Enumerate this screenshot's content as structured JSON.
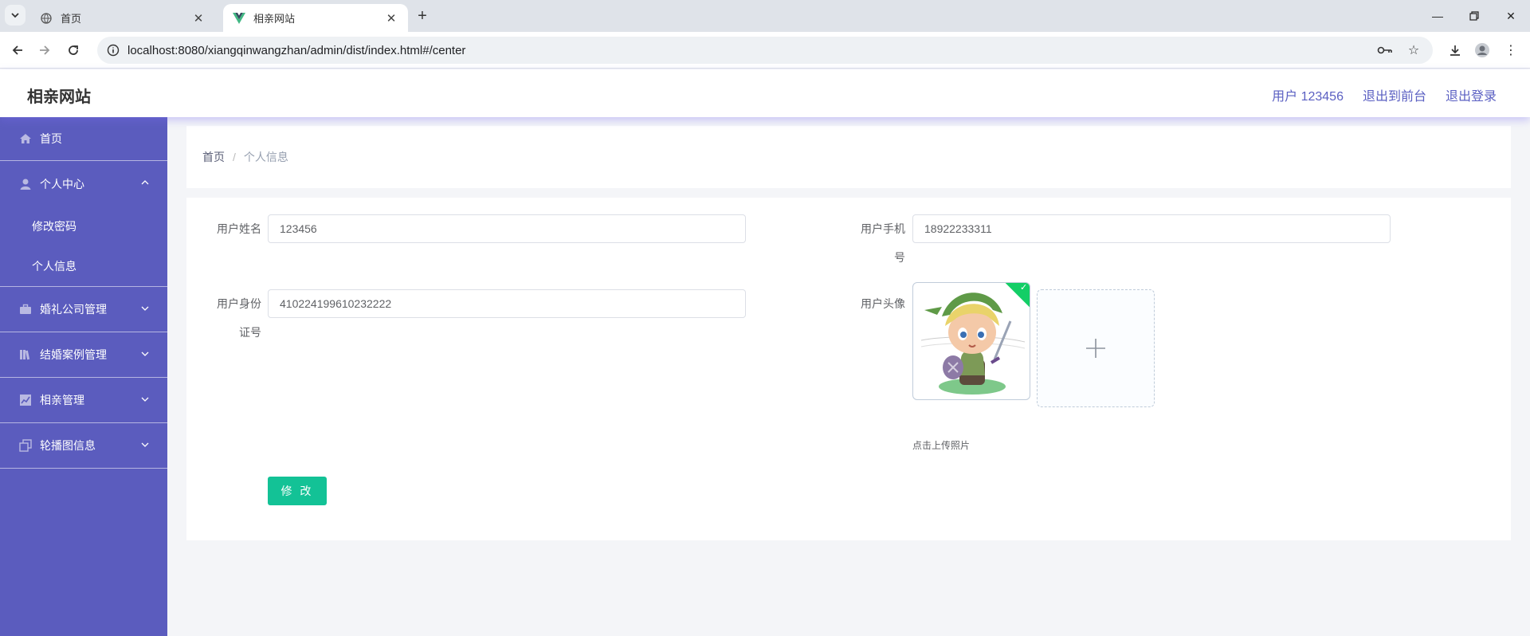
{
  "browser": {
    "tabs": [
      {
        "label": "首页",
        "active": false
      },
      {
        "label": "相亲网站",
        "active": true
      }
    ],
    "url": "localhost:8080/xiangqinwangzhan/admin/dist/index.html#/center"
  },
  "header": {
    "brand": "相亲网站",
    "user_label": "用户 123456",
    "to_front": "退出到前台",
    "logout": "退出登录"
  },
  "sidebar": {
    "home": "首页",
    "personal_center": "个人中心",
    "change_password": "修改密码",
    "personal_info": "个人信息",
    "wedding_company": "婚礼公司管理",
    "wedding_cases": "结婚案例管理",
    "matchmaking": "相亲管理",
    "carousel": "轮播图信息"
  },
  "breadcrumb": {
    "home": "首页",
    "separator": "/",
    "current": "个人信息"
  },
  "form": {
    "username_label": "用户姓名",
    "username_value": "123456",
    "phone_label": "用户手机号",
    "phone_value": "18922233311",
    "idcard_label": "用户身份证号",
    "idcard_value": "410224199610232222",
    "avatar_label": "用户头像",
    "upload_tip": "点击上传照片",
    "submit_label": "修 改"
  },
  "colors": {
    "sidebar_bg": "#5b5cbe",
    "accent": "#5a5fc2",
    "submit": "#13c296"
  }
}
